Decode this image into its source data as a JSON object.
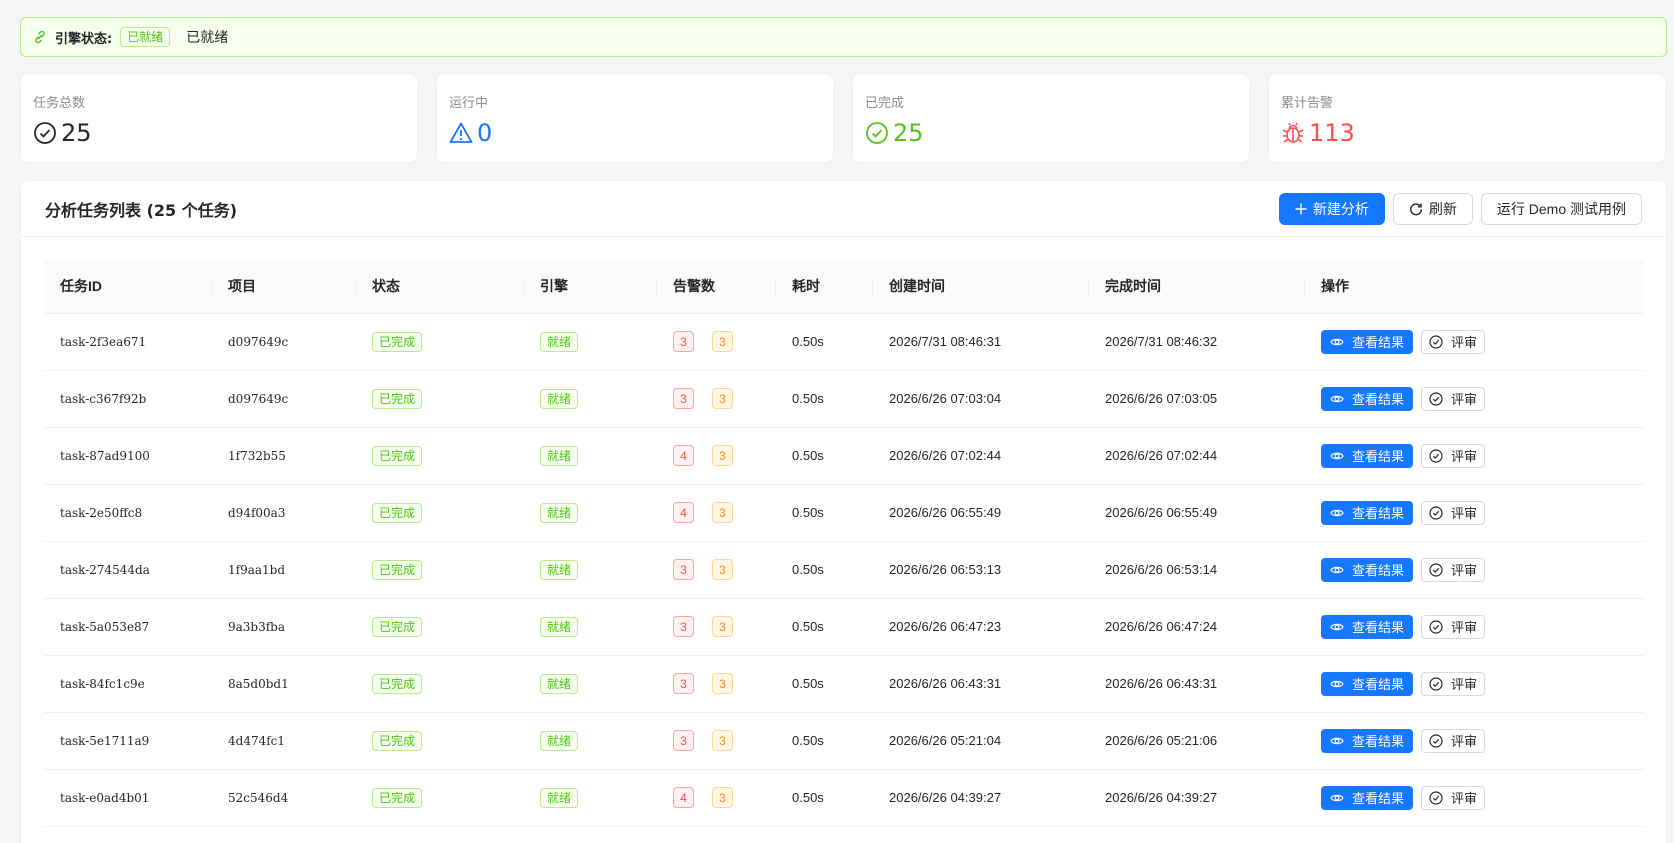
{
  "engine": {
    "label": "引擎状态:",
    "tag": "已就绪",
    "status_text": "已就绪"
  },
  "stats": [
    {
      "title": "任务总数",
      "value": "25",
      "icon": "check-circle-icon",
      "color": "#262626"
    },
    {
      "title": "运行中",
      "value": "0",
      "icon": "warning-icon",
      "color": "#1677ff"
    },
    {
      "title": "已完成",
      "value": "25",
      "icon": "check-circle-icon",
      "color": "#52c41a"
    },
    {
      "title": "累计告警",
      "value": "113",
      "icon": "bug-icon",
      "color": "#ff4d4f"
    }
  ],
  "panel": {
    "title": "分析任务列表 (25 个任务)",
    "buttons": {
      "new_analysis": "新建分析",
      "refresh": "刷新",
      "run_demo": "运行 Demo 测试用例"
    }
  },
  "table": {
    "columns": [
      "任务ID",
      "项目",
      "状态",
      "引擎",
      "告警数",
      "耗时",
      "创建时间",
      "完成时间",
      "操作"
    ],
    "view_label": "查看结果",
    "review_label": "评审",
    "rows": [
      {
        "id": "task-2f3ea671",
        "project": "d097649c",
        "status": "已完成",
        "engine": "就绪",
        "alert_red": "3",
        "alert_orange": "3",
        "duration": "0.50s",
        "created": "2026/7/31 08:46:31",
        "finished": "2026/7/31 08:46:32"
      },
      {
        "id": "task-c367f92b",
        "project": "d097649c",
        "status": "已完成",
        "engine": "就绪",
        "alert_red": "3",
        "alert_orange": "3",
        "duration": "0.50s",
        "created": "2026/6/26 07:03:04",
        "finished": "2026/6/26 07:03:05"
      },
      {
        "id": "task-87ad9100",
        "project": "1f732b55",
        "status": "已完成",
        "engine": "就绪",
        "alert_red": "4",
        "alert_orange": "3",
        "duration": "0.50s",
        "created": "2026/6/26 07:02:44",
        "finished": "2026/6/26 07:02:44"
      },
      {
        "id": "task-2e50ffc8",
        "project": "d94f00a3",
        "status": "已完成",
        "engine": "就绪",
        "alert_red": "4",
        "alert_orange": "3",
        "duration": "0.50s",
        "created": "2026/6/26 06:55:49",
        "finished": "2026/6/26 06:55:49"
      },
      {
        "id": "task-274544da",
        "project": "1f9aa1bd",
        "status": "已完成",
        "engine": "就绪",
        "alert_red": "3",
        "alert_orange": "3",
        "duration": "0.50s",
        "created": "2026/6/26 06:53:13",
        "finished": "2026/6/26 06:53:14"
      },
      {
        "id": "task-5a053e87",
        "project": "9a3b3fba",
        "status": "已完成",
        "engine": "就绪",
        "alert_red": "3",
        "alert_orange": "3",
        "duration": "0.50s",
        "created": "2026/6/26 06:47:23",
        "finished": "2026/6/26 06:47:24"
      },
      {
        "id": "task-84fc1c9e",
        "project": "8a5d0bd1",
        "status": "已完成",
        "engine": "就绪",
        "alert_red": "3",
        "alert_orange": "3",
        "duration": "0.50s",
        "created": "2026/6/26 06:43:31",
        "finished": "2026/6/26 06:43:31"
      },
      {
        "id": "task-5e1711a9",
        "project": "4d474fc1",
        "status": "已完成",
        "engine": "就绪",
        "alert_red": "3",
        "alert_orange": "3",
        "duration": "0.50s",
        "created": "2026/6/26 05:21:04",
        "finished": "2026/6/26 05:21:06"
      },
      {
        "id": "task-e0ad4b01",
        "project": "52c546d4",
        "status": "已完成",
        "engine": "就绪",
        "alert_red": "4",
        "alert_orange": "3",
        "duration": "0.50s",
        "created": "2026/6/26 04:39:27",
        "finished": "2026/6/26 04:39:27"
      }
    ]
  }
}
